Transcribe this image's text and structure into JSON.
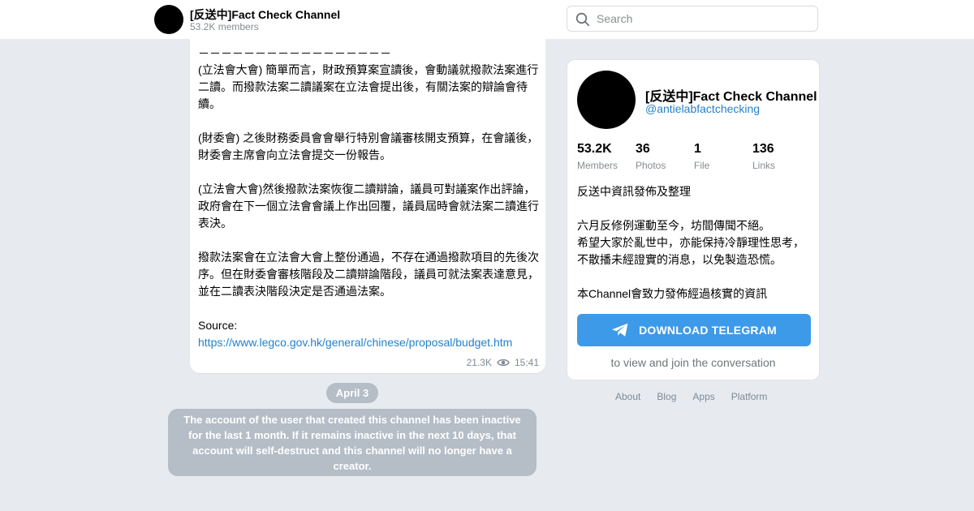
{
  "header": {
    "channel_title": "[反送中]Fact Check Channel",
    "members": "53.2K members",
    "search_placeholder": "Search"
  },
  "message": {
    "dash_line": "－－－－－－－－－－－－－－－－－",
    "paragraphs": [
      "(立法會大會) 簡單而言，財政預算案宣讀後，會動議就撥款法案進行二讀。而撥款法案二讀議案在立法會提出後，有關法案的辯論會待續。",
      "(財委會) 之後財務委員會會舉行特別會議審核開支預算，在會議後，財委會主席會向立法會提交一份報告。",
      "(立法會大會)然後撥款法案恢復二讀辯論，議員可對議案作出評論，政府會在下一個立法會會議上作出回覆，議員屆時會就法案二讀進行表決。",
      "撥款法案會在立法會大會上整份通過，不存在通過撥款項目的先後次序。但在財委會審核階段及二讀辯論階段，議員可就法案表達意見，並在二讀表決階段決定是否通過法案。"
    ],
    "source_label": "Source:",
    "source_link": "https://www.legco.gov.hk/general/chinese/proposal/budget.htm",
    "views": "21.3K",
    "time": "15:41"
  },
  "date_pill": "April 3",
  "service_message": "The account of the user that created this channel has been inactive for the last 1 month. If it remains inactive in the next 10 days, that account will self-destruct and this channel will no longer have a creator.",
  "card": {
    "title": "[反送中]Fact Check Channel",
    "username": "@antielabfactchecking",
    "counters": [
      {
        "value": "53.2K",
        "label": "Members"
      },
      {
        "value": "36",
        "label": "Photos"
      },
      {
        "value": "1",
        "label": "File"
      },
      {
        "value": "136",
        "label": "Links"
      }
    ],
    "description": [
      "反送中資訊發佈及整理",
      "六月反修例運動至今，坊間傳聞不絕。\n希望大家於亂世中，亦能保持冷靜理性思考，不散播未經證實的消息，以免製造恐慌。",
      "本Channel會致力發佈經過核實的資訊"
    ],
    "download_button": "DOWNLOAD TELEGRAM",
    "subtext": "to view and join the conversation"
  },
  "footer": {
    "links": [
      "About",
      "Blog",
      "Apps",
      "Platform"
    ]
  },
  "colors": {
    "background": "#e7ebf0",
    "accent": "#3d9ae8",
    "link": "#2481cc"
  }
}
